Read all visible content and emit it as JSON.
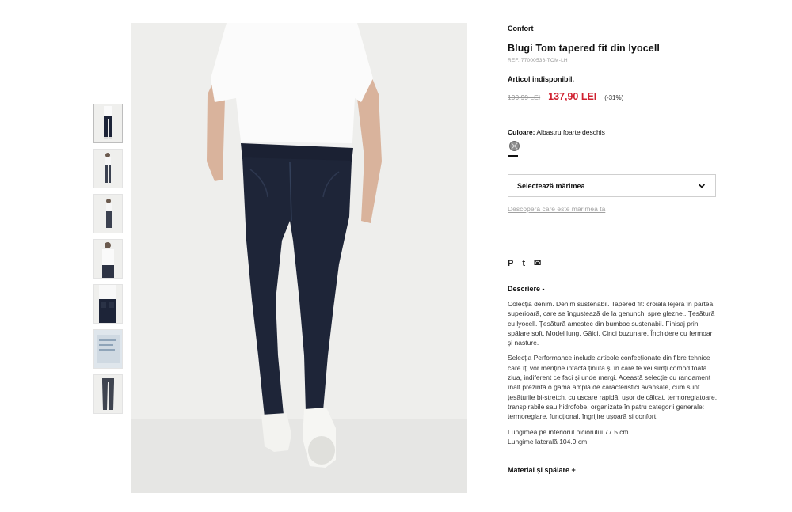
{
  "product": {
    "brand": "Confort",
    "title": "Blugi Tom tapered fit din lyocell",
    "ref": "REF. 77000536-TOM-LH",
    "availability": "Articol indisponibil.",
    "old_price": "199,99 LEI",
    "new_price": "137,90 LEI",
    "discount": "(-31%)",
    "price_color": "#d0202f"
  },
  "color": {
    "label": "Culoare:",
    "value": "Albastru foarte deschis",
    "swatch_icon": "unavailable-color-swatch"
  },
  "size": {
    "select_label": "Selectează mărimea",
    "chevron_icon": "chevron-down-icon",
    "find_size_link": "Descoperă care este mărimea ta"
  },
  "share": {
    "icons": [
      "pinterest-icon",
      "tumblr-icon",
      "mail-icon"
    ],
    "pinterest": "P",
    "tumblr": "t",
    "mail": "✉"
  },
  "description": {
    "heading": "Descriere -",
    "p1": "Colecția denim. Denim sustenabil. Tapered fit: croială lejeră în partea superioară, care se îngustează de la genunchi spre glezne.. Țesătură cu lyocell. Țesătură amestec din bumbac sustenabil. Finisaj prin spălare soft. Model lung. Găici. Cinci buzunare. Închidere cu fermoar și nasture.",
    "p2": "Selecția Performance include articole confecționate din fibre tehnice care îți vor menține intactă ținuta și în care te vei simți comod toată ziua, indiferent ce faci și unde mergi. Această selecție cu randament înalt prezintă o gamă amplă de caracteristici avansate, cum sunt țesăturile bi-stretch, cu uscare rapidă, ușor de călcat, termoreglatoare, transpirabile sau hidrofobe, organizate în patru categorii generale: termoreglare, funcțional, îngrijire ușoară și confort.",
    "inseam": "Lungimea pe interiorul piciorului 77.5 cm",
    "side_length": "Lungime laterală 104.9 cm"
  },
  "material": {
    "heading": "Material și spălare +"
  }
}
